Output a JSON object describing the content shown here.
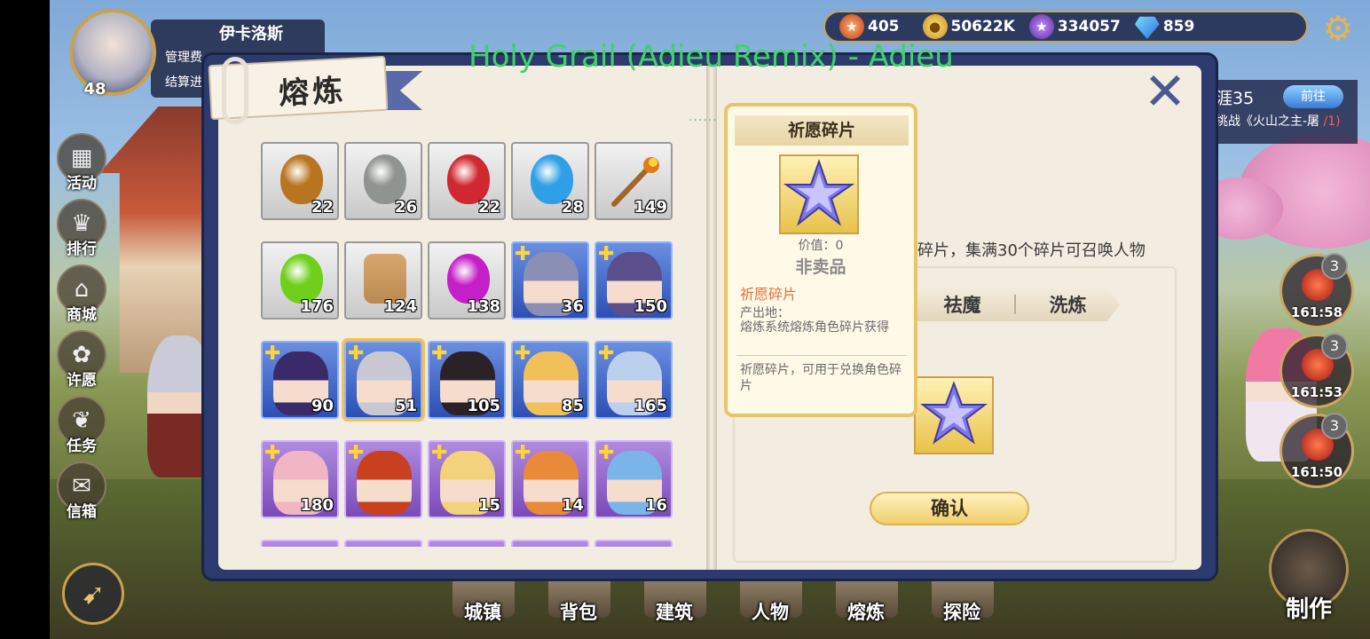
{
  "resources": {
    "medal": "405",
    "gold": "50622K",
    "purple": "334057",
    "gem": "859"
  },
  "profile": {
    "name": "伊卡洛斯",
    "level": "48",
    "line1": "管理费",
    "line2": "结算进"
  },
  "quest": {
    "title": "涯35",
    "go_label": "前往",
    "desc": "挑战《火山之主-屠",
    "progress": "/1)"
  },
  "side_menu": [
    {
      "label": "活动",
      "icon": "event-icon"
    },
    {
      "label": "排行",
      "icon": "ranking-icon"
    },
    {
      "label": "商城",
      "icon": "shop-icon"
    },
    {
      "label": "许愿",
      "icon": "wish-icon"
    },
    {
      "label": "任务",
      "icon": "task-icon"
    },
    {
      "label": "信箱",
      "icon": "mail-icon"
    }
  ],
  "timers": [
    {
      "badge": "3",
      "time": "161:58"
    },
    {
      "badge": "3",
      "time": "161:53"
    },
    {
      "badge": "3",
      "time": "161:50"
    }
  ],
  "bottom_nav": [
    "城镇",
    "背包",
    "建筑",
    "人物",
    "熔炼",
    "探险"
  ],
  "make_label": "制作",
  "panel_title": "熔炼",
  "overlay_song": "Holy Grail (Adieu Remix) - Adieu",
  "overlay_dots": "......",
  "items": [
    {
      "type": "potion",
      "color": "#b8741e",
      "count": "22",
      "frame": "grey"
    },
    {
      "type": "potion",
      "color": "#8f9490",
      "count": "26",
      "frame": "grey"
    },
    {
      "type": "potion",
      "color": "#d0282e",
      "count": "22",
      "frame": "grey"
    },
    {
      "type": "potion",
      "color": "#2f9fe8",
      "count": "28",
      "frame": "grey"
    },
    {
      "type": "torch",
      "color": "#e07a1a",
      "count": "149",
      "frame": "grey"
    },
    {
      "type": "potion",
      "color": "#6fcf1a",
      "count": "176",
      "frame": "grey"
    },
    {
      "type": "bag",
      "color": "#b98a52",
      "count": "124",
      "frame": "grey"
    },
    {
      "type": "potion",
      "color": "#c51fc8",
      "count": "138",
      "frame": "grey"
    },
    {
      "type": "hero",
      "color": "#8a8fb5",
      "count": "36",
      "frame": "blue"
    },
    {
      "type": "hero",
      "color": "#5a4f8a",
      "count": "150",
      "frame": "blue"
    },
    {
      "type": "hero",
      "color": "#3a2a6a",
      "count": "90",
      "frame": "blue"
    },
    {
      "type": "hero",
      "color": "#c8c8d2",
      "count": "51",
      "frame": "blue"
    },
    {
      "type": "hero",
      "color": "#2a2226",
      "count": "105",
      "frame": "blue"
    },
    {
      "type": "hero",
      "color": "#f2c05a",
      "count": "85",
      "frame": "blue"
    },
    {
      "type": "hero",
      "color": "#bcd0ee",
      "count": "165",
      "frame": "blue"
    },
    {
      "type": "hero",
      "color": "#f0b6c4",
      "count": "180",
      "frame": "purple"
    },
    {
      "type": "hero",
      "color": "#c8401e",
      "count": "",
      "frame": "purple"
    },
    {
      "type": "hero",
      "color": "#f2d27a",
      "count": "15",
      "frame": "purple"
    },
    {
      "type": "hero",
      "color": "#e88a3a",
      "count": "14",
      "frame": "purple"
    },
    {
      "type": "hero",
      "color": "#7ab4e8",
      "count": "16",
      "frame": "purple"
    }
  ],
  "tooltip": {
    "title": "祈愿碎片",
    "value": "价值：0",
    "not_for_sale": "非卖品",
    "name": "祈愿碎片",
    "source_label": "产出地：",
    "source": "熔炼系统熔炼角色碎片获得",
    "description": "祈愿碎片，可用于兑换角色碎片"
  },
  "right_page": {
    "desc": "碎片，集满30个碎片可召唤人物",
    "tabs": [
      "祛魔",
      "洗炼"
    ],
    "confirm": "确认"
  },
  "colors": {
    "book_frame": "#2c3a6e",
    "page": "#f3ece0",
    "accent_gold": "#e8c46a",
    "song_green": "#3fd26a"
  }
}
